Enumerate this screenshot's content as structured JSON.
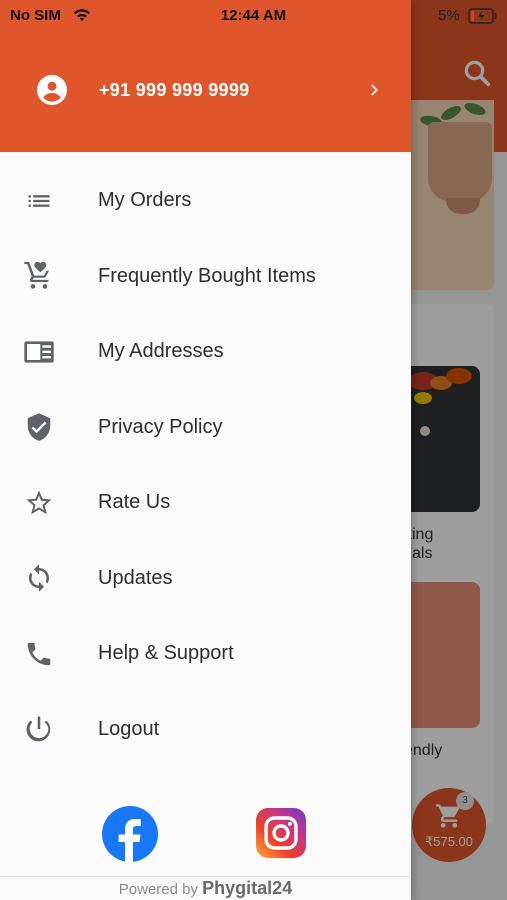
{
  "status_bar": {
    "carrier": "No SIM",
    "time": "12:44 AM",
    "battery": "5%"
  },
  "drawer": {
    "phone": "+91 999 999 9999",
    "menu": [
      {
        "label": "My Orders",
        "icon": "list-icon"
      },
      {
        "label": "Frequently Bought Items",
        "icon": "cart-heart-icon"
      },
      {
        "label": "My Addresses",
        "icon": "address-card-icon"
      },
      {
        "label": "Privacy Policy",
        "icon": "shield-check-icon"
      },
      {
        "label": "Rate Us",
        "icon": "star-outline-icon"
      },
      {
        "label": "Updates",
        "icon": "sync-icon"
      },
      {
        "label": "Help & Support",
        "icon": "phone-icon"
      },
      {
        "label": "Logout",
        "icon": "power-icon"
      }
    ],
    "footer": {
      "powered_by": "Powered by",
      "brand": "Phygital24"
    }
  },
  "background": {
    "card_text_1": "king",
    "card_text_2": "tials",
    "card_text_3": "endly",
    "cart_price": "₹575.00",
    "cart_count": "3"
  },
  "colors": {
    "accent": "#e0562c",
    "drawer_bg": "#fafafa",
    "menu_text": "#2e2e2e",
    "icon": "#5f6368"
  }
}
